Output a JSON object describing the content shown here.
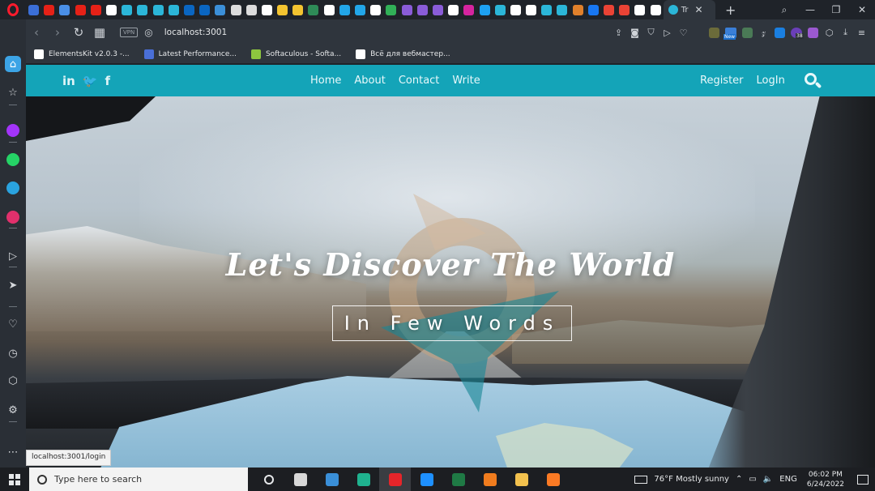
{
  "browser": {
    "tabs": [
      {
        "color": "#3b6fd8"
      },
      {
        "color": "#e62117"
      },
      {
        "color": "#4a8fe7"
      },
      {
        "color": "#e62117"
      },
      {
        "color": "#e62117"
      },
      {
        "color": "#ffffff"
      },
      {
        "color": "#2bb6d8"
      },
      {
        "color": "#2bb6d8"
      },
      {
        "color": "#2bb6d8"
      },
      {
        "color": "#2bb6d8"
      },
      {
        "color": "#0a66c2"
      },
      {
        "color": "#0a66c2"
      },
      {
        "color": "#3b8fd8"
      },
      {
        "color": "#dcdcdc"
      },
      {
        "color": "#dcdcdc"
      },
      {
        "color": "#ffffff"
      },
      {
        "color": "#f4c430"
      },
      {
        "color": "#f4c430"
      },
      {
        "color": "#2e8b57"
      },
      {
        "color": "#ffffff"
      },
      {
        "color": "#22a6e8"
      },
      {
        "color": "#22a6e8"
      },
      {
        "color": "#ffffff"
      },
      {
        "color": "#31b057"
      },
      {
        "color": "#8a5cd8"
      },
      {
        "color": "#8a5cd8"
      },
      {
        "color": "#8a5cd8"
      },
      {
        "color": "#ffffff"
      },
      {
        "color": "#d6249f"
      },
      {
        "color": "#1da1f2"
      },
      {
        "color": "#2bb6d8"
      },
      {
        "color": "#ffffff"
      },
      {
        "color": "#ffffff"
      },
      {
        "color": "#2bb6d8"
      },
      {
        "color": "#2bb6d8"
      },
      {
        "color": "#e0802b"
      },
      {
        "color": "#1877f2"
      },
      {
        "color": "#ea4335"
      },
      {
        "color": "#ea4335"
      },
      {
        "color": "#ffffff"
      },
      {
        "color": "#ffffff"
      }
    ],
    "active_tab_label": "Tr",
    "new_tab_label": "+",
    "window_controls": {
      "search": "⌕",
      "minimize": "—",
      "restore": "❐",
      "close": "✕",
      "menu": "≡"
    },
    "nav": {
      "back": "‹",
      "forward": "›",
      "reload": "↻",
      "tiles": "▦"
    },
    "vpn_label": "VPN",
    "address": "localhost:3001",
    "bookmarks": [
      {
        "label": "ElementsKit v2.0.3 -...",
        "color": "#ffffff"
      },
      {
        "label": "Latest Performance...",
        "color": "#4a6fd8"
      },
      {
        "label": "Softaculous - Softa...",
        "color": "#8ec63f"
      },
      {
        "label": "Всё для вебмастер...",
        "color": "#ffffff"
      }
    ],
    "extension_badge_new": "New",
    "extension_badge_count": "38",
    "status_bar_url": "localhost:3001/login"
  },
  "sidebar": {
    "items": [
      {
        "name": "home",
        "glyph": "⌂"
      },
      {
        "name": "star",
        "glyph": "☆"
      },
      {
        "name": "messenger",
        "color": "#a334fa"
      },
      {
        "name": "whatsapp",
        "color": "#25d366"
      },
      {
        "name": "telegram",
        "color": "#2aa3df"
      },
      {
        "name": "instagram",
        "color": "#e1306c"
      },
      {
        "name": "player",
        "glyph": "▷"
      },
      {
        "name": "send",
        "glyph": "➤"
      },
      {
        "name": "heart",
        "glyph": "♡"
      },
      {
        "name": "history",
        "glyph": "◷"
      },
      {
        "name": "cube",
        "glyph": "⬡"
      },
      {
        "name": "settings",
        "glyph": "⚙"
      },
      {
        "name": "more",
        "glyph": "⋯"
      }
    ]
  },
  "site": {
    "social": [
      {
        "name": "linkedin",
        "glyph": "in"
      },
      {
        "name": "twitter",
        "glyph": "🐦"
      },
      {
        "name": "facebook",
        "glyph": "f"
      }
    ],
    "menu": [
      "Home",
      "About",
      "Contact",
      "Write"
    ],
    "auth": {
      "register": "Register",
      "login": "LogIn"
    },
    "hero": {
      "title": "Let's Discover The World",
      "subtitle": "In Few Words"
    },
    "nav_color": "#14a4b8"
  },
  "taskbar": {
    "search_placeholder": "Type here to search",
    "apps": [
      {
        "name": "cortana",
        "color": ""
      },
      {
        "name": "task-view",
        "color": "#d8d8d8"
      },
      {
        "name": "files",
        "color": "#3a8fd8"
      },
      {
        "name": "edge",
        "color": "#1fb28f"
      },
      {
        "name": "opera",
        "color": "#e5252a"
      },
      {
        "name": "vscode",
        "color": "#1e90ff"
      },
      {
        "name": "excel",
        "color": "#1f7a45"
      },
      {
        "name": "sublime",
        "color": "#f07c1e"
      },
      {
        "name": "explorer",
        "color": "#f2c14e"
      },
      {
        "name": "xampp",
        "color": "#fb7a24"
      }
    ],
    "weather": "76°F  Mostly sunny",
    "language": "ENG",
    "time": "06:02 PM",
    "date": "6/24/2022"
  }
}
